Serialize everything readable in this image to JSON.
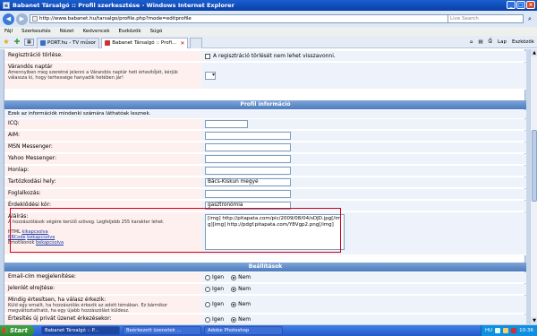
{
  "window": {
    "title": "Babanet Társalgó :: Profil szerkesztése - Windows Internet Explorer",
    "minimize": "_",
    "maximize": "□",
    "close": "×"
  },
  "address": {
    "url": "http://www.babanet.hu/tarsalgo/profile.php?mode=editprofile",
    "search_placeholder": "Live Search"
  },
  "menu": [
    "Fájl",
    "Szerkesztés",
    "Nézet",
    "Kedvencek",
    "Eszközök",
    "Súgó"
  ],
  "tabs": [
    {
      "label": "PORT.hu - TV műsor",
      "active": false
    },
    {
      "label": "Babanet Társalgó :: Profi...",
      "active": true
    }
  ],
  "commands": {
    "home": "⌂",
    "feeds": "▤",
    "print": "⎙",
    "page": "Lap",
    "tools": "Eszközök"
  },
  "form": {
    "top_rows": [
      {
        "label": "Regisztráció törlése.",
        "checkbox_text": "A regisztráció törlését nem lehet visszavonni."
      },
      {
        "label": "Várandós naptár",
        "desc": "Amennyiben meg szeretné jelenni a Várandós naptár heti értesítőjét, kérjük válassza ki, hogy terhessége hanyadik hetében jár!"
      }
    ],
    "profile_header": "Profil információ",
    "profile_note": "Ezek az információk mindenki számára láthatóak lesznek.",
    "fields": [
      {
        "label": "ICQ:",
        "value": ""
      },
      {
        "label": "AIM:",
        "value": ""
      },
      {
        "label": "MSN Messenger:",
        "value": ""
      },
      {
        "label": "Yahoo Messenger:",
        "value": ""
      },
      {
        "label": "Honlap:",
        "value": ""
      },
      {
        "label": "Tartózkodási hely:",
        "value": "Bács-Kiskun megye"
      },
      {
        "label": "Foglalkozás:",
        "value": ""
      },
      {
        "label": "Érdeklődési kör:",
        "value": "gasztronómia"
      }
    ],
    "signature": {
      "label": "Aláírás:",
      "desc": "A hozzászólások végére kerülő szöveg. Legfeljebb 255 karakter lehet.",
      "html_text": "HTML",
      "html_state": "kikapcsolva",
      "bbcode_link": "BBCode",
      "bbcode_state": "bekapcsolva",
      "emoticons_text": "Emotikonok",
      "emoticons_state": "bekapcsolva",
      "value": "[img] http://pitapata.com/pic/2009/08/04/sDJD.jpg[/img][img] http://pdgf.pitapata.com/Y8Vgp2.png[/img]"
    },
    "settings_header": "Beállítások",
    "settings": [
      {
        "label": "Email-cím megjelenítése:",
        "desc": "",
        "yes": "Igen",
        "no": "Nem",
        "selected": "no"
      },
      {
        "label": "Jelenlét elrejtése:",
        "desc": "",
        "yes": "Igen",
        "no": "Nem",
        "selected": "no"
      },
      {
        "label": "Mindig értesítsen, ha válasz érkezik:",
        "desc": "Küld egy emailt, ha hozzászólás érkezik az adott témában. Ez bármikor megváltoztatható, ha egy újabb hozzászólást küldesz.",
        "yes": "Igen",
        "no": "Nem",
        "selected": "no"
      },
      {
        "label": "Értesítés új privát üzenet érkezésekor:",
        "desc": "",
        "yes": "Igen",
        "no": "Nem",
        "selected": "no"
      }
    ]
  },
  "taskbar": {
    "start": "Start",
    "tasks": [
      {
        "label": "Babanet Társalgó :: P...",
        "active": true
      },
      {
        "label": "Beérkezett üzenetek ...",
        "active": false
      },
      {
        "label": "Adobe Photoshop",
        "active": false
      }
    ],
    "lang": "HU",
    "clock": "10:36"
  }
}
